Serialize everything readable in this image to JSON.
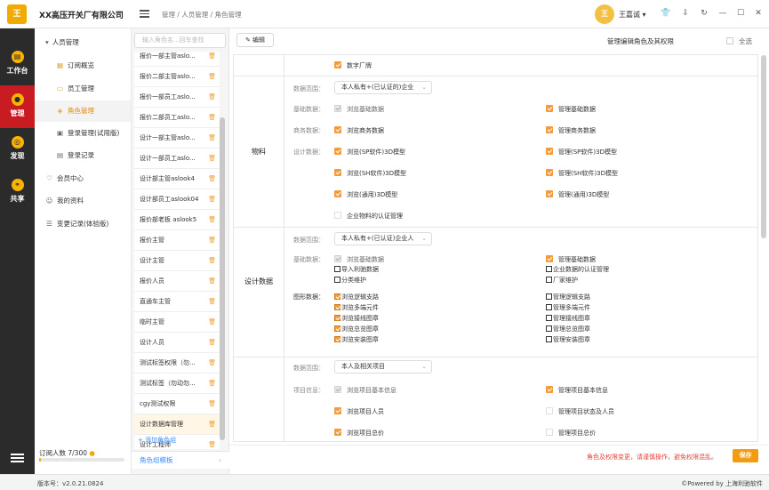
{
  "app": {
    "logo_text": "王",
    "company": "XX高压开关厂有限公司",
    "breadcrumb": "管理 / 人员管理 / 角色管理",
    "avatar_text": "王",
    "user": "王嘉诚 ▾",
    "icons": [
      "shirt-icon",
      "download-icon",
      "refresh-icon",
      "minimize-icon",
      "maximize-icon",
      "close-icon"
    ]
  },
  "rail": [
    {
      "label": "工作台",
      "icon": "workbench-icon"
    },
    {
      "label": "管理",
      "icon": "manage-icon",
      "active": true
    },
    {
      "label": "发现",
      "icon": "discover-icon"
    },
    {
      "label": "共享",
      "icon": "share-icon"
    }
  ],
  "nav": {
    "group": "人员管理",
    "items": [
      {
        "label": "订阅概览",
        "icon": "grid-icon"
      },
      {
        "label": "员工管理",
        "icon": "doc-icon"
      },
      {
        "label": "角色管理",
        "icon": "role-icon",
        "active": true
      },
      {
        "label": "登录管理(试用版)",
        "icon": "login-icon"
      },
      {
        "label": "登录记录",
        "icon": "record-icon"
      }
    ],
    "top_items": [
      {
        "label": "会员中心",
        "icon": "member-icon"
      },
      {
        "label": "我的资料",
        "icon": "user-icon"
      },
      {
        "label": "变更记录(体验版)",
        "icon": "change-icon"
      }
    ],
    "subscription": "订阅人数 7/300",
    "subscription_fraction": 0.023
  },
  "roles": {
    "search_placeholder": "输入角色名...回车查找",
    "list": [
      "报价一部主管aslo...",
      "报价二部主管aslo...",
      "报价一部员工aslo...",
      "报价二部员工aslo...",
      "设计一部主管aslo...",
      "设计一部员工aslo...",
      "设计部主管aslook4",
      "设计部员工aslook04",
      "报价部老板 aslook5",
      "报价主管",
      "设计主管",
      "报价人员",
      "直通车主管",
      "临时主管",
      "设计人员",
      "测试标签权限（勿...",
      "测试标签（勿动勿...",
      "cgy测试权限",
      "设计数据库管理",
      "设计工程师"
    ],
    "active_index": 18,
    "add_label": "+ 添加角色组",
    "template_label": "角色组模板",
    "template_chevron": "›"
  },
  "main": {
    "edit_label": "✎ 编辑",
    "title": "管理编辑角色及其权限",
    "select_all": "全选",
    "top_perm": "数字厂牌",
    "sections": {
      "material": {
        "title": "物料",
        "scope_label": "数据范围：",
        "scope_value": "本人私有+(已认证的)企业",
        "basic_label": "基础数据：",
        "basic_left": "浏览基础数据",
        "basic_right": "管理基础数据",
        "biz_label": "商务数据：",
        "biz_left": "浏览商务数据",
        "biz_right": "管理商务数据",
        "design_label": "设计数据：",
        "d1_left": "浏览(SP软件)3D模型",
        "d1_right": "管理(SP软件)3D模型",
        "d2_left": "浏览(SH软件)3D模型",
        "d2_right": "管理(SH软件)3D模型",
        "d3_left": "浏览(通用)3D模型",
        "d3_right": "管理(通用)3D模型",
        "cert": "企业物料的认证管理"
      },
      "design": {
        "title": "设计数据",
        "scope_label": "数据范围：",
        "scope_value": "本人私有+(已认证)企业人",
        "basic_label": "基础数据：",
        "basic_left": "浏览基础数据",
        "basic_right": "管理基础数据",
        "import": "导入利驰数据",
        "cert": "企业数据的认证管理",
        "classify": "分类维护",
        "vendor": "厂家维护",
        "graphic_label": "图形数据：",
        "g_left": [
          "浏览逻辑支路",
          "浏览多端元件",
          "浏览接线图章",
          "浏览总览图章",
          "浏览安装图章"
        ],
        "g_right": [
          "管理逻辑支路",
          "管理多端元件",
          "管理接线图章",
          "管理总览图章",
          "管理安装图章"
        ]
      },
      "project": {
        "scope_label": "数据范围：",
        "scope_value": "本人及相关项目",
        "info_label": "项目信息：",
        "p1_left": "浏览项目基本信息",
        "p1_right": "管理项目基本信息",
        "p2_left": "浏览项目人员",
        "p2_right": "管理项目状态及人员",
        "p3_left": "浏览项目总价",
        "p3_right": "管理项目总价"
      }
    },
    "warning": "角色及权限变更，请谨慎操作，避免权限混乱。",
    "save_label": "保存"
  },
  "status": {
    "version": "版本号：v2.0.21.0824",
    "powered": "©Powered by 上海利驰软件"
  },
  "colors": {
    "accent": "#f39c12",
    "rail": "#2b2b2b",
    "active_rail": "#c81c22",
    "warn": "#e5443a",
    "link": "#3d8df5"
  }
}
